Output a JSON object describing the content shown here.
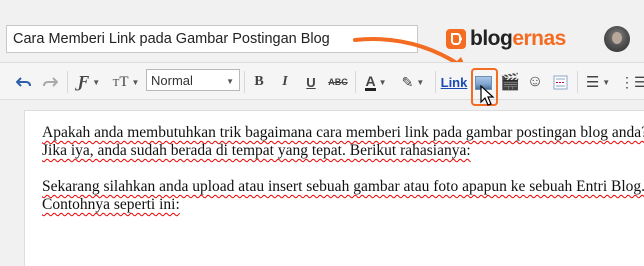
{
  "header": {
    "post_title": "Cara Memberi Link pada Gambar Postingan Blog",
    "logo": {
      "text_dark": "blog",
      "text_accent": "ernas",
      "accent_color": "#f36c21"
    }
  },
  "toolbar": {
    "font_size_value": "Normal",
    "bold_label": "B",
    "italic_label": "I",
    "underline_label": "U",
    "strike_label": "ABC",
    "text_color_label": "A",
    "link_label": "Link",
    "icons": [
      "undo-icon",
      "redo-icon",
      "font-family-icon",
      "text-size-icon",
      "bold-icon",
      "italic-icon",
      "underline-icon",
      "strikethrough-icon",
      "text-color-icon",
      "highlight-icon",
      "link-icon",
      "insert-image-icon",
      "insert-video-icon",
      "emoji-icon",
      "jump-break-icon",
      "align-icon",
      "list-icon"
    ]
  },
  "editor": {
    "lines": [
      "Apakah anda membutuhkan trik bagaimana cara memberi link pada gambar postingan blog anda?",
      "Jika iya, anda sudah berada di tempat yang tepat. Berikut rahasianya:",
      "",
      "Sekarang silahkan anda upload atau insert sebuah gambar atau foto apapun ke sebuah Entri Blog.",
      "Contohnya seperti ini:"
    ]
  },
  "annotation": {
    "highlight_color": "#f36c21"
  }
}
